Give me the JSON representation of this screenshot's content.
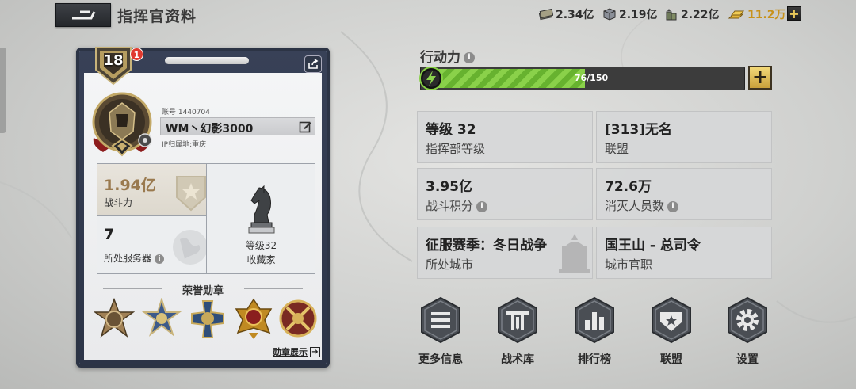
{
  "header": {
    "title": "指挥官资料",
    "back_icon": "back-arrow-icon"
  },
  "resources": [
    {
      "icon": "cash-stack-icon",
      "value": "2.34亿"
    },
    {
      "icon": "steel-cube-icon",
      "value": "2.19亿"
    },
    {
      "icon": "oil-barrels-icon",
      "value": "2.22亿"
    },
    {
      "icon": "gold-bars-icon",
      "value": "11.2万",
      "color": "#c8921a"
    }
  ],
  "profile": {
    "level": "18",
    "notification_count": "1",
    "account_label": "账号 1440704",
    "name": "WM丶幻影3000",
    "ip_label": "IP归属地:重庆",
    "power_value": "1.94亿",
    "power_label": "战斗力",
    "server_value": "7",
    "server_label": "所处服务器",
    "collector_level": "等级32",
    "collector_label": "收藏家",
    "honor_title": "荣誉勋章",
    "medal_show_label": "勋章展示"
  },
  "action_points": {
    "label": "行动力",
    "text": "76/150",
    "current": 76,
    "max": 150
  },
  "info": [
    {
      "value": "等级 32",
      "label": "指挥部等级"
    },
    {
      "value": "[313]无名",
      "label": "联盟"
    },
    {
      "value": "3.95亿",
      "label": "战斗积分"
    },
    {
      "value": "72.6万",
      "label": "消灭人员数"
    },
    {
      "value": "征服赛季：冬日战争",
      "label": "所处城市"
    },
    {
      "value": "国王山 - 总司令",
      "label": "城市官职"
    }
  ],
  "actions": [
    {
      "label": "更多信息",
      "icon": "list-menu-icon"
    },
    {
      "label": "战术库",
      "icon": "tactics-book-icon"
    },
    {
      "label": "排行榜",
      "icon": "bar-chart-icon"
    },
    {
      "label": "联盟",
      "icon": "alliance-star-icon"
    },
    {
      "label": "设置",
      "icon": "gear-icon"
    }
  ],
  "colors": {
    "power_value": "#9a7a4f",
    "ap_fill": "#7cc540",
    "card_frame": "#2c3445"
  }
}
